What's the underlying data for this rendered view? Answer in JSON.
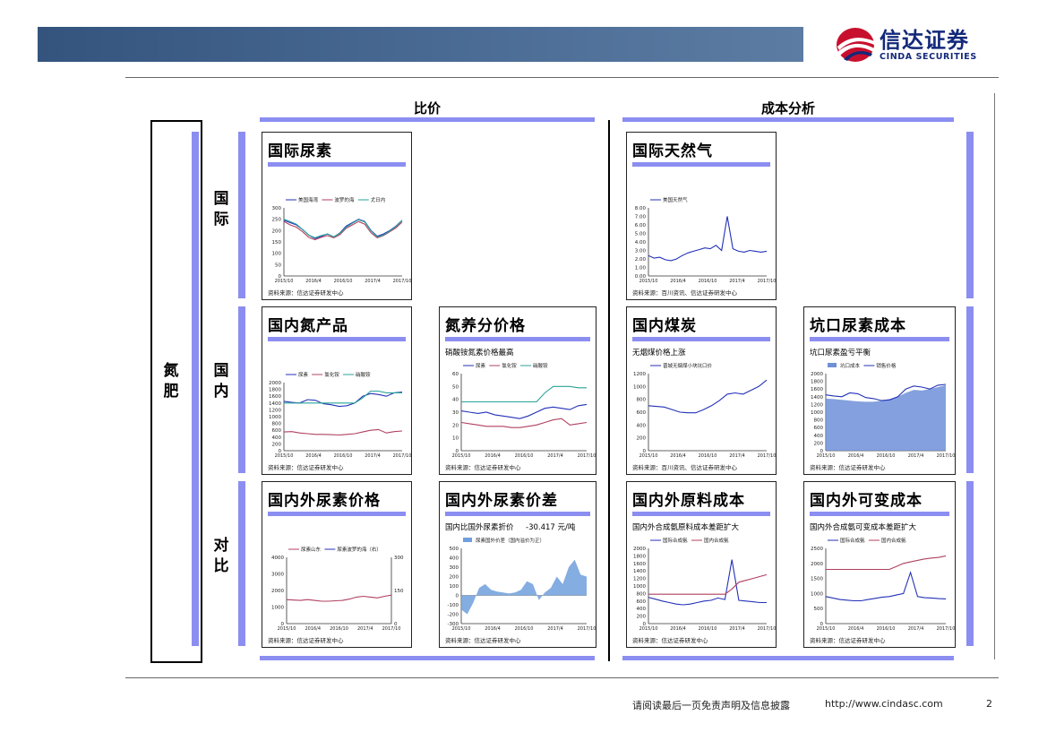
{
  "header": {
    "logo_cn": "信达证券",
    "logo_en": "CINDA SECURITIES",
    "colors": {
      "bar": "#3d5e89",
      "brand_red": "#c8102e",
      "brand_blue": "#13297a",
      "accent": "#8b8ef0"
    }
  },
  "sections": {
    "left": "比价",
    "right": "成本分析"
  },
  "row_labels": {
    "main": "氮肥",
    "r1": "国际",
    "r2": "国内",
    "r3": "对比"
  },
  "footer": {
    "disclaimer": "请阅读最后一页免责声明及信息披露",
    "url": "http://www.cindasc.com",
    "page": "2"
  },
  "panels": [
    {
      "id": "p1",
      "title": "国际尿素",
      "subtitle": "",
      "source": "资料来源：信达证券研发中心",
      "chart_data": {
        "type": "line",
        "x_ticks": [
          "2015/10",
          "2016/4",
          "2016/10",
          "2017/4",
          "2017/10"
        ],
        "ylim": [
          0,
          300
        ],
        "y_ticks": [
          0,
          50,
          100,
          150,
          200,
          250,
          300
        ],
        "legend": [
          "美国海湾",
          "波罗的海",
          "尤日内"
        ],
        "series": [
          {
            "name": "美国海湾",
            "color": "#2331b7",
            "values": [
              245,
              235,
              225,
              205,
              180,
              165,
              175,
              185,
              172,
              190,
              220,
              235,
              250,
              240,
              200,
              175,
              185,
              200,
              220,
              245
            ]
          },
          {
            "name": "波罗的海",
            "color": "#b0405f",
            "values": [
              240,
              225,
              215,
              195,
              170,
              160,
              170,
              178,
              168,
              182,
              210,
              225,
              240,
              228,
              190,
              168,
              178,
              195,
              212,
              238
            ]
          },
          {
            "name": "尤日内",
            "color": "#2aa398",
            "values": [
              250,
              240,
              228,
              205,
              180,
              168,
              178,
              185,
              172,
              188,
              215,
              232,
              248,
              238,
              198,
              172,
              180,
              198,
              218,
              245
            ]
          }
        ]
      }
    },
    {
      "id": "p2",
      "title": "国际天然气",
      "subtitle": "",
      "source": "资料来源：百川资讯、信达证券研发中心",
      "chart_data": {
        "type": "line",
        "x_ticks": [
          "2015/10",
          "2016/4",
          "2016/10",
          "2017/4",
          "2017/10"
        ],
        "ylim": [
          0,
          8
        ],
        "y_ticks": [
          "0.00",
          "1.00",
          "2.00",
          "3.00",
          "4.00",
          "5.00",
          "6.00",
          "7.00",
          "8.00"
        ],
        "legend": [
          "美国天然气"
        ],
        "series": [
          {
            "name": "美国天然气",
            "color": "#2331b7",
            "values": [
              2.4,
              2.1,
              2.2,
              1.9,
              1.8,
              2.0,
              2.4,
              2.7,
              2.9,
              3.1,
              3.3,
              3.2,
              3.6,
              3.0,
              7.0,
              3.2,
              2.9,
              2.8,
              3.0,
              2.9,
              2.8,
              2.9
            ]
          }
        ]
      }
    },
    {
      "id": "p3",
      "title": "国内氮产品",
      "subtitle": "",
      "source": "资料来源：信达证券研发中心",
      "chart_data": {
        "type": "line",
        "x_ticks": [
          "2015/10",
          "2016/4",
          "2016/10",
          "2017/4",
          "2017/10"
        ],
        "ylim": [
          0,
          2000
        ],
        "y_ticks": [
          0,
          200,
          400,
          600,
          800,
          1000,
          1200,
          1400,
          1600,
          1800,
          2000
        ],
        "legend": [
          "尿素",
          "氯化铵",
          "硝酸铵"
        ],
        "series": [
          {
            "name": "尿素",
            "color": "#2331b7",
            "values": [
              1450,
              1420,
              1400,
              1500,
              1480,
              1380,
              1350,
              1300,
              1320,
              1400,
              1600,
              1680,
              1650,
              1600,
              1700,
              1720
            ]
          },
          {
            "name": "氯化铵",
            "color": "#b0405f",
            "values": [
              550,
              560,
              520,
              500,
              480,
              480,
              470,
              460,
              480,
              500,
              550,
              600,
              620,
              520,
              560,
              580
            ]
          },
          {
            "name": "硝酸铵",
            "color": "#2aa398",
            "values": [
              1400,
              1400,
              1400,
              1400,
              1400,
              1400,
              1400,
              1400,
              1400,
              1400,
              1550,
              1750,
              1750,
              1700,
              1700,
              1700
            ]
          }
        ]
      }
    },
    {
      "id": "p4",
      "title": "氮养分价格",
      "subtitle": "硝酸铵氮素价格最高",
      "source": "资料来源：信达证券研发中心",
      "chart_data": {
        "type": "line",
        "x_ticks": [
          "2015/10",
          "2016/4",
          "2016/10",
          "2017/4",
          "2017/10"
        ],
        "ylim": [
          0,
          60
        ],
        "y_ticks": [
          0,
          10,
          20,
          30,
          40,
          50,
          60
        ],
        "legend": [
          "尿素",
          "氯化铵",
          "硝酸铵"
        ],
        "series": [
          {
            "name": "尿素",
            "color": "#2331b7",
            "values": [
              31,
              30,
              29,
              30,
              28,
              27,
              26,
              25,
              27,
              30,
              33,
              34,
              33,
              32,
              35,
              36
            ]
          },
          {
            "name": "氯化铵",
            "color": "#b0405f",
            "values": [
              22,
              21,
              20,
              19,
              19,
              19,
              18,
              18,
              19,
              20,
              22,
              24,
              25,
              20,
              21,
              22
            ]
          },
          {
            "name": "硝酸铵",
            "color": "#2aa398",
            "values": [
              38,
              38,
              38,
              38,
              38,
              38,
              38,
              38,
              38,
              38,
              45,
              50,
              50,
              50,
              49,
              49
            ]
          }
        ]
      }
    },
    {
      "id": "p5",
      "title": "国内煤炭",
      "subtitle": "无烟煤价格上涨",
      "source": "资料来源：百川资讯、信达证券研发中心",
      "chart_data": {
        "type": "line",
        "x_ticks": [
          "2015/10",
          "2016/4",
          "2016/10",
          "2017/4",
          "2017/10"
        ],
        "ylim": [
          0,
          1200
        ],
        "y_ticks": [
          0,
          200,
          400,
          600,
          800,
          1000,
          1200
        ],
        "legend": [
          "晋城无烟煤小块坑口价"
        ],
        "series": [
          {
            "name": "晋城无烟煤小块坑口价",
            "color": "#2331b7",
            "values": [
              700,
              690,
              680,
              640,
              600,
              590,
              590,
              640,
              700,
              780,
              880,
              900,
              880,
              940,
              1000,
              1100
            ]
          }
        ]
      }
    },
    {
      "id": "p6",
      "title": "坑口尿素成本",
      "subtitle": "坑口尿素盈亏平衡",
      "source": "资料来源：信达证券研发中心",
      "chart_data": {
        "type": "area",
        "x_ticks": [
          "2015/10",
          "2016/4",
          "2016/10",
          "2017/4",
          "2017/10"
        ],
        "ylim": [
          0,
          2000
        ],
        "y_ticks": [
          0,
          200,
          400,
          600,
          800,
          1000,
          1200,
          1400,
          1600,
          1800,
          2000
        ],
        "legend": [
          "坑口成本",
          "销售价格"
        ],
        "series": [
          {
            "name": "坑口成本",
            "color": "#6f8fd8",
            "values": [
              1350,
              1340,
              1320,
              1300,
              1280,
              1270,
              1270,
              1300,
              1340,
              1400,
              1500,
              1580,
              1560,
              1600,
              1650,
              1700
            ]
          },
          {
            "name": "销售价格",
            "color": "#2331b7",
            "values": [
              1450,
              1420,
              1400,
              1500,
              1480,
              1380,
              1350,
              1300,
              1320,
              1400,
              1600,
              1680,
              1650,
              1600,
              1700,
              1720
            ]
          }
        ]
      }
    },
    {
      "id": "p7",
      "title": "国内外尿素价格",
      "subtitle": "",
      "source": "资料来源：信达证券研发中心",
      "chart_data": {
        "type": "line",
        "x_ticks": [
          "2015/10",
          "2016/4",
          "2016/10",
          "2017/4",
          "2017/10"
        ],
        "ylim": [
          0,
          4000
        ],
        "y_ticks": [
          0,
          1000,
          2000,
          3000,
          4000
        ],
        "y2lim": [
          0,
          300
        ],
        "y2_ticks": [
          0,
          150,
          300
        ],
        "legend": [
          "尿素山东",
          "尿素波罗的海（右）"
        ],
        "series": [
          {
            "name": "尿素山东",
            "color": "#b0405f",
            "values": [
              1450,
              1420,
              1400,
              1450,
              1400,
              1350,
              1350,
              1380,
              1400,
              1480,
              1600,
              1650,
              1600,
              1550,
              1650,
              1720
            ]
          },
          {
            "name": "尿素波罗的海（右）",
            "color": "#2331b7",
            "values": [
              3400,
              3100,
              2900,
              2600,
              2400,
              2300,
              2400,
              2500,
              2350,
              2600,
              3000,
              3200,
              3000,
              2500,
              2600,
              3300
            ]
          }
        ]
      }
    },
    {
      "id": "p8",
      "title": "国内外尿素价差",
      "subtitle": "国内比国外尿素折价",
      "subtitle2": "-30.417 元/吨",
      "source": "资料来源：信达证券研发中心",
      "chart_data": {
        "type": "area",
        "x_ticks": [
          "2015/10",
          "2016/4",
          "2016/10",
          "2017/4",
          "2017/10"
        ],
        "ylim": [
          -300,
          500
        ],
        "y_ticks": [
          -300,
          -200,
          -100,
          0,
          100,
          200,
          300,
          400,
          500
        ],
        "legend": [
          "尿素国外价差（国内溢价为正）"
        ],
        "series": [
          {
            "name": "尿素国外价差（国内溢价为正）",
            "color": "#6f9fdc",
            "values": [
              -150,
              -200,
              -80,
              80,
              120,
              60,
              40,
              30,
              20,
              30,
              60,
              150,
              120,
              -50,
              30,
              80,
              200,
              120,
              300,
              380,
              220,
              200
            ]
          }
        ]
      }
    },
    {
      "id": "p9",
      "title": "国内外原料成本",
      "subtitle": "国内外合成氨原料成本差距扩大",
      "source": "资料来源：信达证券研发中心",
      "chart_data": {
        "type": "line",
        "x_ticks": [
          "2015/10",
          "2016/4",
          "2016/10",
          "2017/4",
          "2017/10"
        ],
        "ylim": [
          0,
          2000
        ],
        "y_ticks": [
          0,
          200,
          400,
          600,
          800,
          1000,
          1200,
          1400,
          1600,
          1800,
          2000
        ],
        "legend": [
          "国际合成氨",
          "国内合成氨"
        ],
        "series": [
          {
            "name": "国际合成氨",
            "color": "#2331b7",
            "values": [
              700,
              650,
              600,
              560,
              520,
              500,
              520,
              560,
              600,
              620,
              680,
              640,
              1700,
              620,
              600,
              580,
              560,
              560
            ]
          },
          {
            "name": "国内合成氨",
            "color": "#b0405f",
            "values": [
              780,
              780,
              780,
              780,
              780,
              780,
              780,
              780,
              780,
              780,
              780,
              780,
              920,
              1100,
              1150,
              1200,
              1250,
              1300
            ]
          }
        ]
      }
    },
    {
      "id": "p10",
      "title": "国内外可变成本",
      "subtitle": "国内外合成氨可变成本差距扩大",
      "source": "资料来源：信达证券研发中心",
      "chart_data": {
        "type": "line",
        "x_ticks": [
          "2015/10",
          "2016/4",
          "2016/10",
          "2017/4",
          "2017/10"
        ],
        "ylim": [
          0,
          2500
        ],
        "y_ticks": [
          0,
          500,
          1000,
          1500,
          2000,
          2500
        ],
        "legend": [
          "国际合成氨",
          "国内合成氨"
        ],
        "series": [
          {
            "name": "国际合成氨",
            "color": "#2331b7",
            "values": [
              900,
              850,
              800,
              780,
              760,
              760,
              800,
              840,
              880,
              900,
              950,
              1000,
              1700,
              900,
              860,
              850,
              830,
              820
            ]
          },
          {
            "name": "国内合成氨",
            "color": "#b0405f",
            "values": [
              1800,
              1800,
              1800,
              1800,
              1800,
              1800,
              1800,
              1800,
              1800,
              1800,
              1900,
              2000,
              2050,
              2100,
              2150,
              2180,
              2200,
              2250
            ]
          }
        ]
      }
    }
  ]
}
